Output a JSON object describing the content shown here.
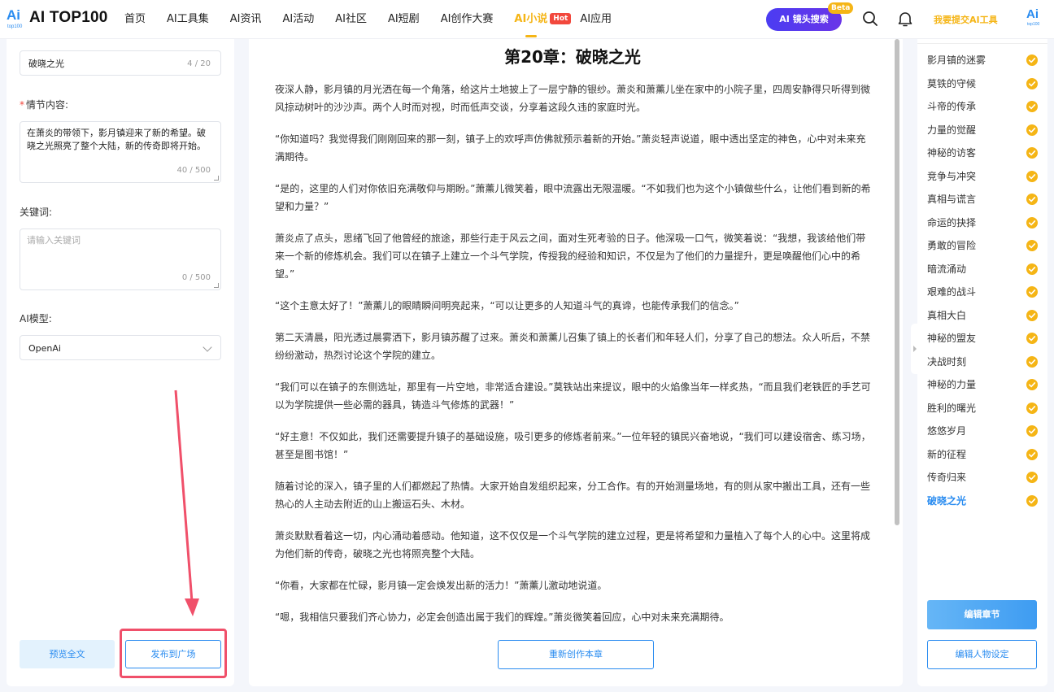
{
  "header": {
    "logo_text": "AI TOP100",
    "nav": [
      {
        "label": "首页",
        "active": false
      },
      {
        "label": "AI工具集",
        "active": false
      },
      {
        "label": "AI资讯",
        "active": false
      },
      {
        "label": "AI活动",
        "active": false
      },
      {
        "label": "AI社区",
        "active": false
      },
      {
        "label": "AI短剧",
        "active": false
      },
      {
        "label": "AI创作大赛",
        "active": false
      },
      {
        "label": "AI小说",
        "active": true,
        "badge": "Hot"
      },
      {
        "label": "AI应用",
        "active": false
      }
    ],
    "search_button": "AI 镜头搜索",
    "search_badge": "Beta",
    "submit_tool": "我要提交AI工具"
  },
  "left": {
    "title_value": "破晓之光",
    "title_counter": "4 / 20",
    "plot_label": "情节内容:",
    "plot_value": "在萧炎的带领下，影月镇迎来了新的希望。破晓之光照亮了整个大陆，新的传奇即将开始。",
    "plot_counter": "40 / 500",
    "keywords_label": "关键词:",
    "keywords_placeholder": "请输入关键词",
    "keywords_counter": "0 / 500",
    "model_label": "AI模型:",
    "model_value": "OpenAi",
    "preview_button": "预览全文",
    "publish_button": "发布到广场"
  },
  "main": {
    "chapter_title": "第20章：破晓之光",
    "paragraphs": [
      "夜深人静，影月镇的月光洒在每一个角落，给这片土地披上了一层宁静的银纱。萧炎和萧薰儿坐在家中的小院子里，四周安静得只听得到微风掠动树叶的沙沙声。两个人时而对视，时而低声交谈，分享着这段久违的家庭时光。",
      "“你知道吗？我觉得我们刚刚回来的那一刻，镇子上的欢呼声仿佛就预示着新的开始。”萧炎轻声说道，眼中透出坚定的神色，心中对未来充满期待。",
      "“是的，这里的人们对你依旧充满敬仰与期盼。”萧薰儿微笑着，眼中流露出无限温暖。“不如我们也为这个小镇做些什么，让他们看到新的希望和力量？”",
      "萧炎点了点头，思绪飞回了他曾经的旅途，那些行走于风云之间，面对生死考验的日子。他深吸一口气，微笑着说：“我想，我该给他们带来一个新的修炼机会。我们可以在镇子上建立一个斗气学院，传授我的经验和知识，不仅是为了他们的力量提升，更是唤醒他们心中的希望。”",
      "“这个主意太好了！”萧薰儿的眼睛瞬间明亮起来，“可以让更多的人知道斗气的真谛，也能传承我们的信念。”",
      "第二天清晨，阳光透过晨雾洒下，影月镇苏醒了过来。萧炎和萧薰儿召集了镇上的长者们和年轻人们，分享了自己的想法。众人听后，不禁纷纷激动，热烈讨论这个学院的建立。",
      "“我们可以在镇子的东侧选址，那里有一片空地，非常适合建设。”莫铁站出来提议，眼中的火焰像当年一样炙热，“而且我们老铁匠的手艺可以为学院提供一些必需的器具，铸造斗气修炼的武器！”",
      "“好主意！不仅如此，我们还需要提升镇子的基础设施，吸引更多的修炼者前来。”一位年轻的镇民兴奋地说，“我们可以建设宿舍、练习场，甚至是图书馆！”",
      "随着讨论的深入，镇子里的人们都燃起了热情。大家开始自发组织起来，分工合作。有的开始测量场地，有的则从家中搬出工具，还有一些热心的人主动去附近的山上搬运石头、木材。",
      "萧炎默默看着这一切，内心涌动着感动。他知道，这不仅仅是一个斗气学院的建立过程，更是将希望和力量植入了每个人的心中。这里将成为他们新的传奇，破晓之光也将照亮整个大陆。",
      "“你看，大家都在忙碌，影月镇一定会焕发出新的活力！”萧薰儿激动地说道。",
      "“嗯，我相信只要我们齐心协力，必定会创造出属于我们的辉煌。”萧炎微笑着回应，心中对未来充满期待。"
    ],
    "recreate_button": "重新创作本章"
  },
  "right": {
    "chapters": [
      {
        "label": "影月镇的迷雾",
        "current": false
      },
      {
        "label": "莫铁的守候",
        "current": false
      },
      {
        "label": "斗帝的传承",
        "current": false
      },
      {
        "label": "力量的觉醒",
        "current": false
      },
      {
        "label": "神秘的访客",
        "current": false
      },
      {
        "label": "竞争与冲突",
        "current": false
      },
      {
        "label": "真相与谎言",
        "current": false
      },
      {
        "label": "命运的抉择",
        "current": false
      },
      {
        "label": "勇敢的冒险",
        "current": false
      },
      {
        "label": "暗流涌动",
        "current": false
      },
      {
        "label": "艰难的战斗",
        "current": false
      },
      {
        "label": "真相大白",
        "current": false
      },
      {
        "label": "神秘的盟友",
        "current": false
      },
      {
        "label": "决战时刻",
        "current": false
      },
      {
        "label": "神秘的力量",
        "current": false
      },
      {
        "label": "胜利的曙光",
        "current": false
      },
      {
        "label": "悠悠岁月",
        "current": false
      },
      {
        "label": "新的征程",
        "current": false
      },
      {
        "label": "传奇归来",
        "current": false
      },
      {
        "label": "破晓之光",
        "current": true
      }
    ],
    "edit_chapter_button": "编辑章节",
    "edit_characters_button": "编辑人物设定"
  },
  "colors": {
    "accent_blue": "#2a8cf0",
    "accent_gold": "#f5b516",
    "hot_red": "#f2483d",
    "annotation_red": "#f0506a"
  },
  "icons": [
    "logo-icon",
    "search-icon",
    "bell-icon",
    "check-circle-icon",
    "chevron-down-icon",
    "collapse-arrow-icon"
  ]
}
